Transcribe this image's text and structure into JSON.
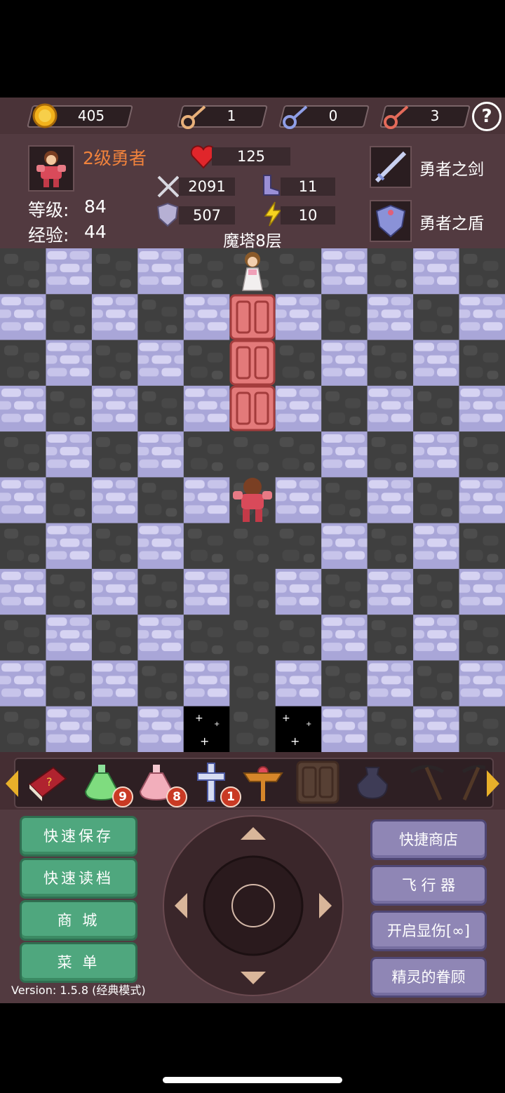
{
  "topbar": {
    "gold": "405",
    "yellow_keys": "1",
    "blue_keys": "0",
    "red_keys": "3",
    "help_label": "?"
  },
  "hero": {
    "title": "2级勇者",
    "level_label": "等级:",
    "level_value": "84",
    "exp_label": "经验:",
    "exp_value": "44",
    "hp": "125",
    "attack": "2091",
    "agility": "11",
    "defense": "507",
    "magic": "10",
    "floor": "魔塔8层"
  },
  "equipment": {
    "weapon": "勇者之剑",
    "shield": "勇者之盾"
  },
  "items": [
    {
      "name": "monster-manual-icon",
      "count": ""
    },
    {
      "name": "green-potion-icon",
      "count": "9"
    },
    {
      "name": "pink-potion-icon",
      "count": "8"
    },
    {
      "name": "cross-icon",
      "count": "1"
    },
    {
      "name": "winged-staff-icon",
      "count": ""
    },
    {
      "name": "door-icon",
      "count": ""
    },
    {
      "name": "dark-vase-icon",
      "count": ""
    },
    {
      "name": "pickaxe-icon",
      "count": ""
    },
    {
      "name": "pickaxe-icon",
      "count": ""
    }
  ],
  "buttons": {
    "quick_save": "快速保存",
    "quick_load": "快速读档",
    "mall": "商 城",
    "menu": "菜 单",
    "quick_shop": "快捷商店",
    "flyer": "飞 行 器",
    "damage_toggle": "开启显伤[∞]",
    "fairy": "精灵的眷顾"
  },
  "version": "Version: 1.5.8 (经典模式)",
  "colors": {
    "hero_title": "#f0823c",
    "green_button": "#4fa77e",
    "purple_button": "#8f86b5",
    "panel": "#523a40"
  }
}
